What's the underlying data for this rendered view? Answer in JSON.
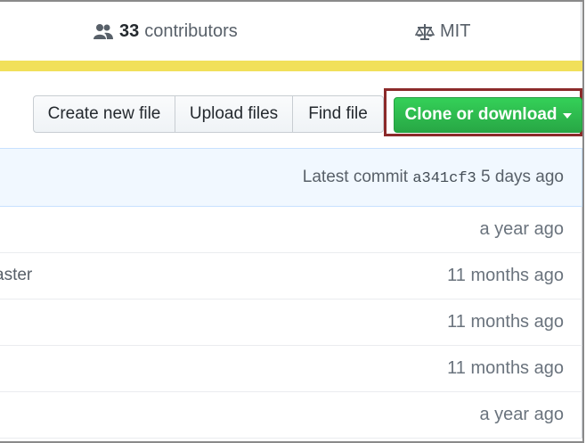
{
  "summary": {
    "contributors_count": "33",
    "contributors_label": "contributors",
    "contributors_icon": "people-icon",
    "license_label": "MIT",
    "license_icon": "law-icon"
  },
  "language_bar": {
    "color": "#f1e05a"
  },
  "file_navigation": {
    "create_new_file": "Create new file",
    "upload_files": "Upload files",
    "find_file": "Find file",
    "clone_or_download": "Clone or download"
  },
  "commit_tease": {
    "prefix": "Latest commit",
    "sha": "a341cf3",
    "age": "5 days ago"
  },
  "files": [
    {
      "message": "",
      "age": "a year ago"
    },
    {
      "message": "aster",
      "age": "11 months ago"
    },
    {
      "message": "",
      "age": "11 months ago"
    },
    {
      "message": "",
      "age": "11 months ago"
    },
    {
      "message": "",
      "age": "a year ago"
    }
  ],
  "colors": {
    "clone_button": "#28a745",
    "highlight_border": "#8b2a2a",
    "commit_bg": "#f1f8ff"
  }
}
